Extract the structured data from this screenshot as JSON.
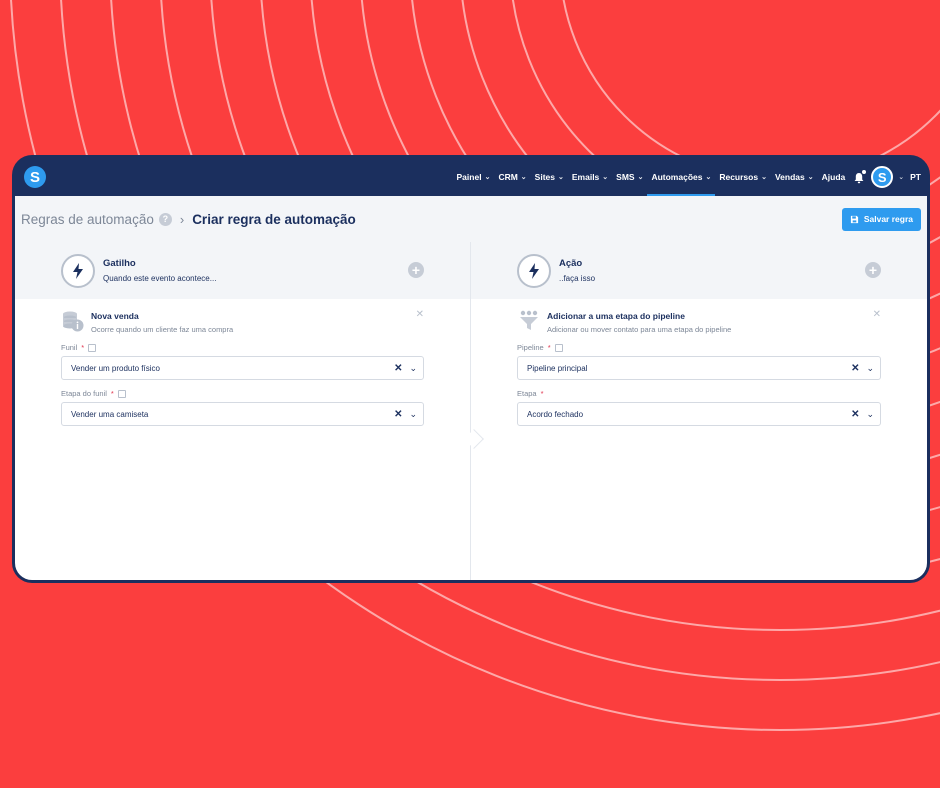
{
  "topbar": {
    "logo_letter": "S",
    "nav": [
      {
        "label": "Painel",
        "active": false
      },
      {
        "label": "CRM",
        "active": false
      },
      {
        "label": "Sites",
        "active": false
      },
      {
        "label": "Emails",
        "active": false
      },
      {
        "label": "SMS",
        "active": false
      },
      {
        "label": "Automações",
        "active": true
      },
      {
        "label": "Recursos",
        "active": false
      },
      {
        "label": "Vendas",
        "active": false
      }
    ],
    "help_label": "Ajuda",
    "avatar_letter": "S",
    "language": "PT"
  },
  "header": {
    "breadcrumb_parent": "Regras de automação",
    "help_icon": "?",
    "breadcrumb_current": "Criar regra de automação",
    "save_label": "Salvar regra"
  },
  "trigger": {
    "title": "Gatilho",
    "subtitle": "Quando este evento acontece...",
    "card_title": "Nova venda",
    "card_subtitle": "Ocorre quando um cliente faz uma compra",
    "fields": [
      {
        "label": "Funil",
        "value": "Vender um produto físico",
        "required": true
      },
      {
        "label": "Etapa do funil",
        "value": "Vender uma camiseta",
        "required": true
      }
    ]
  },
  "action": {
    "title": "Ação",
    "subtitle": "..faça isso",
    "card_title": "Adicionar a uma etapa do pipeline",
    "card_subtitle": "Adicionar ou mover contato para uma etapa do pipeline",
    "fields": [
      {
        "label": "Pipeline",
        "value": "Pipeline principal",
        "required": true
      },
      {
        "label": "Etapa",
        "value": "Acordo fechado",
        "required": true
      }
    ]
  },
  "colors": {
    "background": "#fb3e3e",
    "navbar": "#1b2f5e",
    "accent": "#2e9bef"
  }
}
